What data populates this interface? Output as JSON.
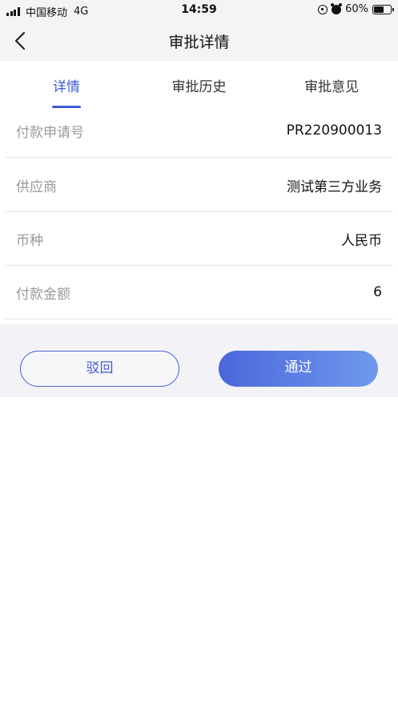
{
  "status_bar": {
    "carrier": "中国移动",
    "network": "4G",
    "time": "14:59",
    "battery_percent": "60%",
    "battery_level": 0.6
  },
  "nav": {
    "title": "审批详情"
  },
  "tabs": [
    {
      "label": "详情",
      "active": true
    },
    {
      "label": "审批历史",
      "active": false
    },
    {
      "label": "审批意见",
      "active": false
    }
  ],
  "details": [
    {
      "label": "付款申请号",
      "value": "PR220900013"
    },
    {
      "label": "供应商",
      "value": "测试第三方业务"
    },
    {
      "label": "币种",
      "value": "人民币"
    },
    {
      "label": "付款金额",
      "value": "6"
    }
  ],
  "actions": {
    "reject_label": "驳回",
    "approve_label": "通过"
  },
  "colors": {
    "accent": "#3d5bd6",
    "approve_gradient_start": "#4a66da",
    "approve_gradient_end": "#6f99ee"
  }
}
